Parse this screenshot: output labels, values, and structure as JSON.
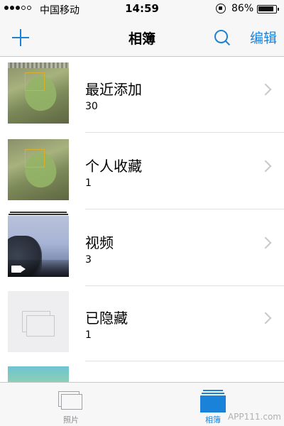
{
  "status_bar": {
    "carrier": "中国移动",
    "time": "14:59",
    "battery_percent": "86%"
  },
  "nav": {
    "title": "相簿",
    "edit_label": "编辑",
    "add_icon": "plus-icon",
    "search_icon": "search-icon"
  },
  "albums": [
    {
      "name": "最近添加",
      "count": "30",
      "thumb": "leaf-photo"
    },
    {
      "name": "个人收藏",
      "count": "1",
      "thumb": "leaf-photo"
    },
    {
      "name": "视频",
      "count": "3",
      "thumb": "sky-tree-photo"
    },
    {
      "name": "已隐藏",
      "count": "1",
      "thumb": "hidden-placeholder"
    },
    {
      "name": "",
      "count": "",
      "thumb": "game-screenshot"
    }
  ],
  "tabs": [
    {
      "label": "照片",
      "icon": "photos-icon",
      "active": false
    },
    {
      "label": "相簿",
      "icon": "albums-icon",
      "active": true
    }
  ],
  "watermark": "APP111.com",
  "colors": {
    "accent": "#1a82d8",
    "chevron": "#c7c7cc",
    "bar_background": "#f7f7f7"
  }
}
